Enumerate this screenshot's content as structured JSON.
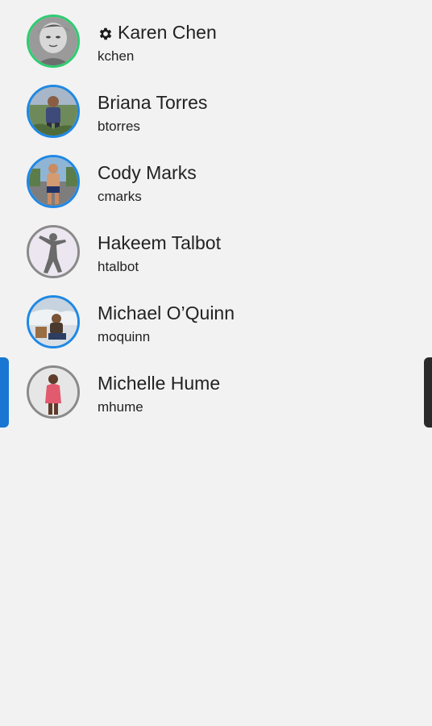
{
  "colors": {
    "background": "#f2f2f2",
    "online_ring": "#2ecc71",
    "active_ring": "#1e88e5",
    "idle_ring": "#8a8a8a",
    "left_tab": "#1976d2",
    "right_tab": "#2a2a2a"
  },
  "users": [
    {
      "name": "Karen Chen",
      "handle": "kchen",
      "icon": "gear-icon",
      "ring": "online"
    },
    {
      "name": "Briana Torres",
      "handle": "btorres",
      "ring": "active"
    },
    {
      "name": "Cody Marks",
      "handle": "cmarks",
      "ring": "active"
    },
    {
      "name": "Hakeem Talbot",
      "handle": "htalbot",
      "ring": "idle"
    },
    {
      "name": "Michael O’Quinn",
      "handle": "moquinn",
      "ring": "active"
    },
    {
      "name": "Michelle Hume",
      "handle": "mhume",
      "ring": "idle"
    }
  ]
}
